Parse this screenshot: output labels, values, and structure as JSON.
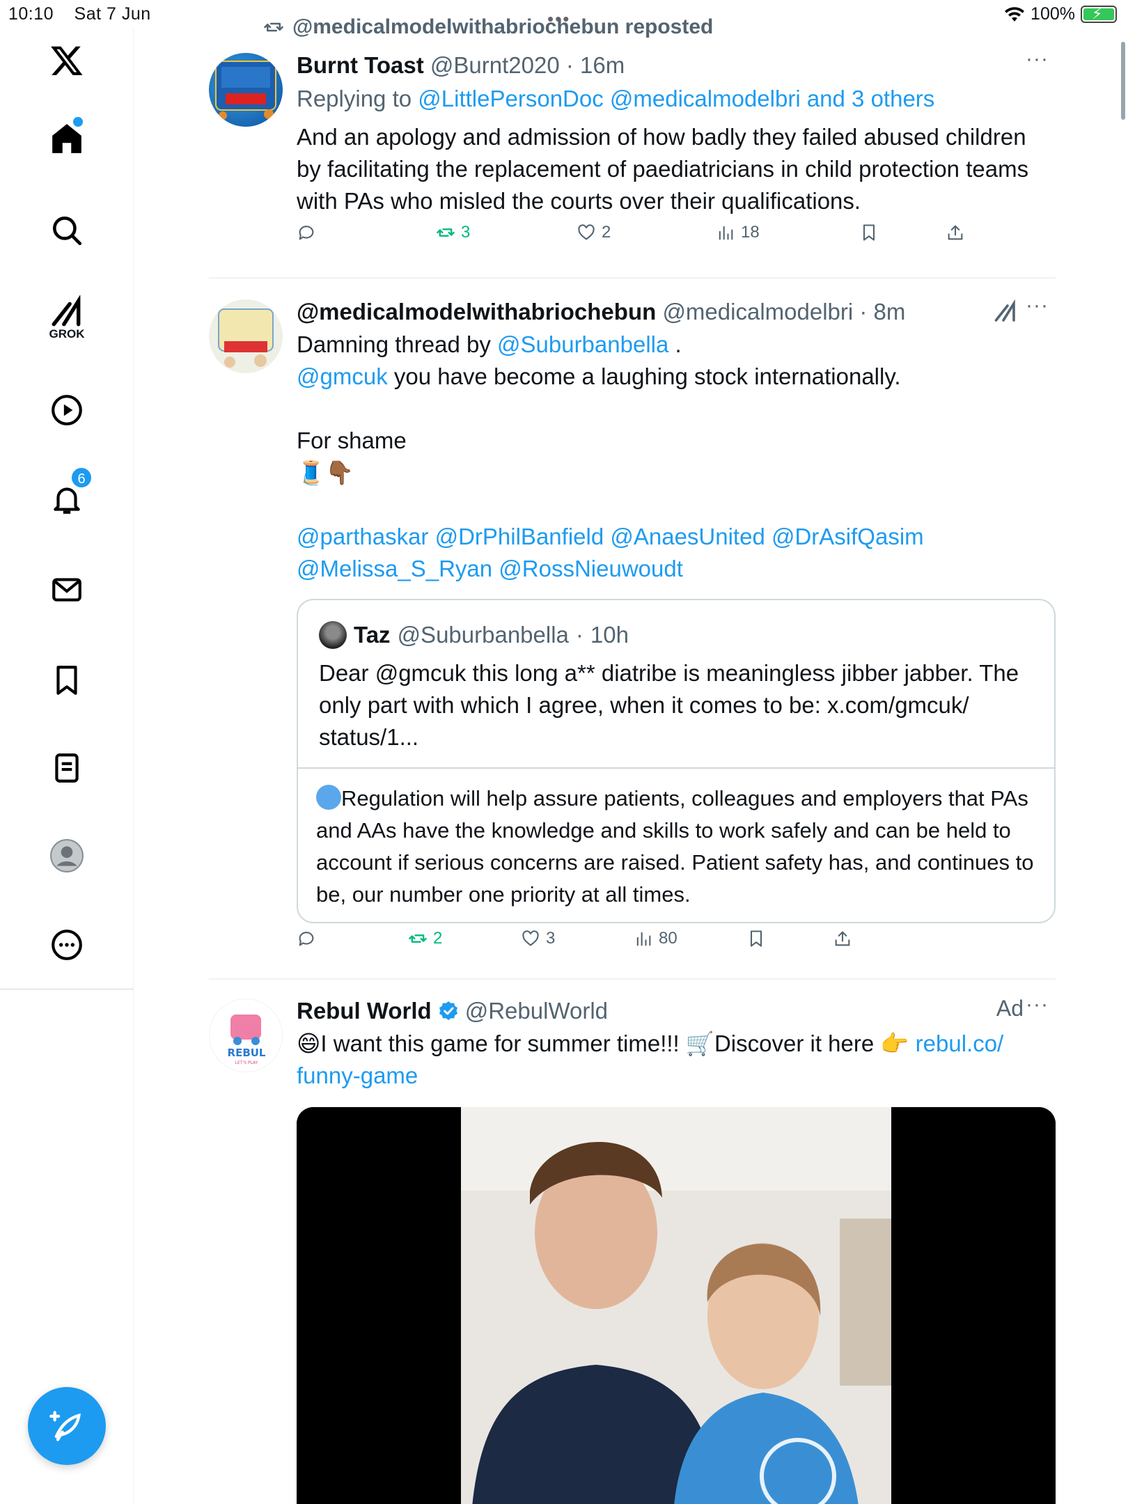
{
  "status": {
    "time": "10:10",
    "date": "Sat 7 Jun",
    "battery": "100%"
  },
  "sidebar": {
    "items": [
      {
        "name": "x-logo"
      },
      {
        "name": "home"
      },
      {
        "name": "search"
      },
      {
        "name": "grok",
        "label": "GROK"
      },
      {
        "name": "video"
      },
      {
        "name": "notifications",
        "badge": "6"
      },
      {
        "name": "messages"
      },
      {
        "name": "bookmarks"
      },
      {
        "name": "lists"
      },
      {
        "name": "profile"
      },
      {
        "name": "more"
      }
    ]
  },
  "repost_header": "@medicalmodelwithabriochebun reposted",
  "posts": [
    {
      "name": "Burnt Toast",
      "handle": "@Burnt2020",
      "time": "16m",
      "more": "···",
      "replying_prefix": "Replying to",
      "replying_to": "@LittlePersonDoc @medicalmodelbri and 3 others",
      "text": "And an apology and admission of how badly they failed abused children by facilitating the replacement of paediatricians in child protection teams with PAs who misled the courts over their qualifications.",
      "retweets": "3",
      "likes": "2",
      "views": "18"
    },
    {
      "name": "@medicalmodelwithabriochebun",
      "handle": "@medicalmodelbri",
      "time": "8m",
      "more": "···",
      "line1_prefix": "Damning thread by",
      "line1_link": "@Suburbanbella",
      "line1_suffix": ".",
      "line2_link": "@gmcuk",
      "line2_text": "you have become a laughing stock internationally.",
      "line3": "For shame",
      "line4": "🧵👇🏾",
      "mentions_line1": "@parthaskar @DrPhilBanfield @AnaesUnited @DrAsifQasim",
      "mentions_line2": "@Melissa_S_Ryan @RossNieuwoudt",
      "quote": {
        "name": "Taz",
        "handle": "@Suburbanbella",
        "time": "10h",
        "text": "Dear @gmcuk this long a** diatribe is meaningless jibber jabber. The only part with which I agree, when it comes to be: x.com/gmcuk/ status/1...",
        "card_text": "Regulation will help assure patients, colleagues and employers that PAs and AAs have the knowledge and skills to work safely and can be held to account if serious concerns are raised. Patient safety has, and continues to be, our number one priority at all times."
      },
      "retweets": "2",
      "likes": "3",
      "views": "80"
    },
    {
      "name": "Rebul World",
      "handle": "@RebulWorld",
      "ad_label": "Ad",
      "more": "···",
      "text_prefix": "😄I want this game for summer time!!! 🛒Discover it here 👉",
      "text_link1": "rebul.co/",
      "text_link2": "funny-game",
      "avatar_text": "REBUL",
      "avatar_sub": "LET'S PLAY"
    }
  ],
  "colors": {
    "accent": "#1d9bf0",
    "retweet": "#00ba7c",
    "muted": "#536471"
  }
}
